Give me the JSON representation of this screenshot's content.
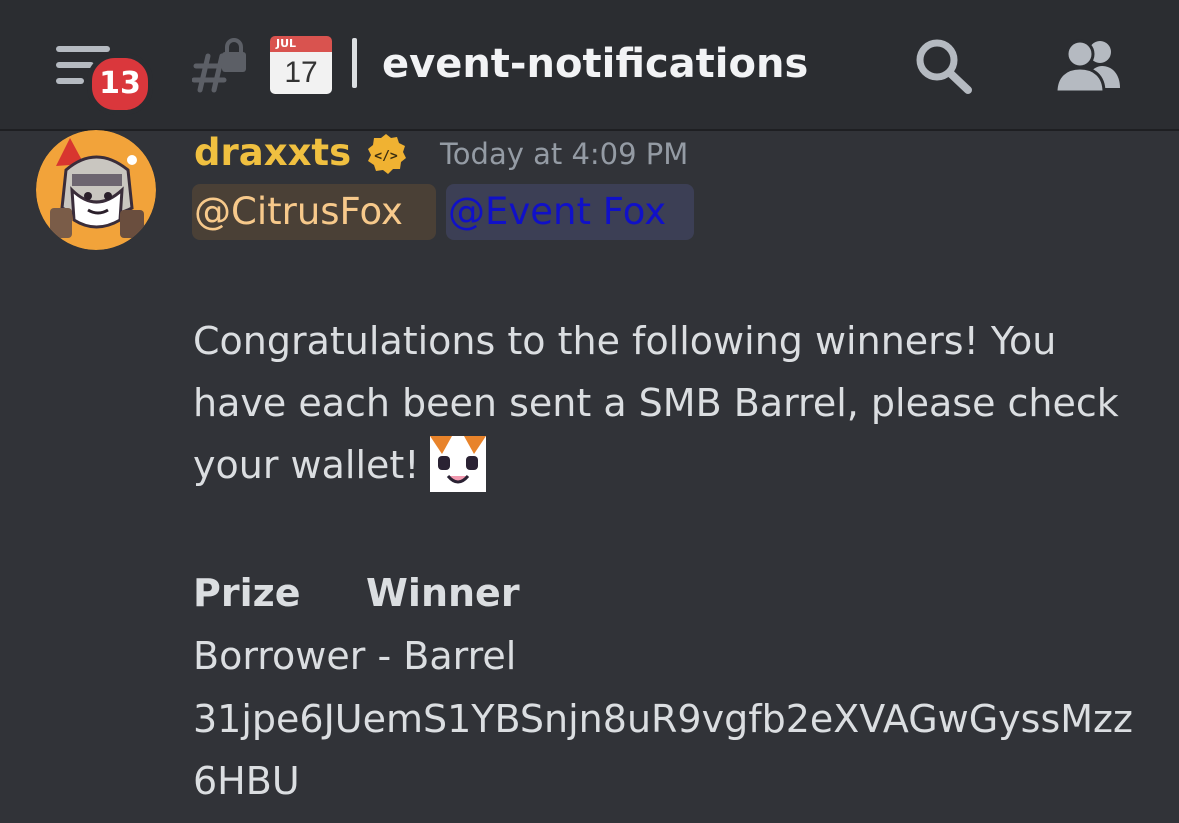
{
  "header": {
    "notification_count": "13",
    "calendar_month": "JUL",
    "calendar_day": "17",
    "channel_name": "event-notifications"
  },
  "message": {
    "author": "draxxts",
    "timestamp": "Today at 4:09 PM",
    "mentions": [
      "@CitrusFox",
      "@Event Fox"
    ],
    "body": "Congratulations to the following winners! You have each been sent a SMB Barrel, please check your wallet!",
    "table": {
      "headers": [
        "Prize",
        "Winner"
      ],
      "rows": [
        {
          "prize": "Borrower - Barrel",
          "winner": "31jpe6JUemS1YBSnjn8uR9vgfb2eXVAGwGyssMzz6HBU"
        }
      ]
    }
  },
  "colors": {
    "background": "#313338",
    "header": "#2b2d31",
    "username": "#f0c040",
    "badge": "#da373c",
    "mention_user_bg": "#4a4036",
    "mention_role_bg": "#3c3f55"
  },
  "icons": [
    "hamburger-menu-icon",
    "locked-channel-icon",
    "calendar-icon",
    "search-icon",
    "members-icon",
    "developer-badge-icon"
  ]
}
